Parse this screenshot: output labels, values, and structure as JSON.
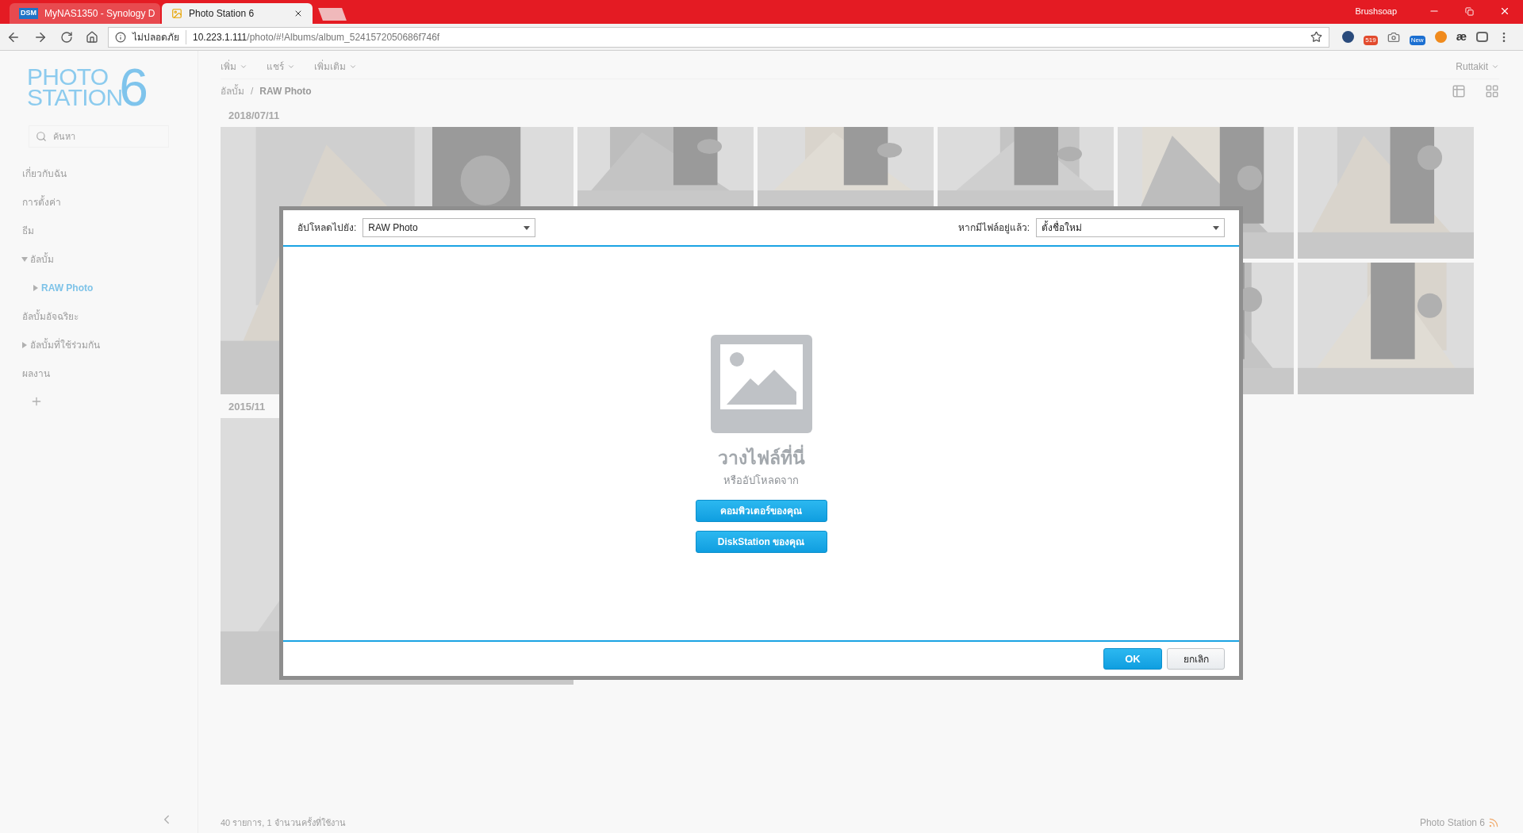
{
  "browser": {
    "tabs": [
      {
        "title": "MyNAS1350 - Synology D",
        "favicon": "DSM",
        "selected": false
      },
      {
        "title": "Photo Station 6",
        "selected": true
      }
    ],
    "profile": "Brushsoap",
    "address": {
      "security": "ไม่ปลอดภัย",
      "host": "10.223.1.111",
      "path": "/photo/#!Albums/album_5241572050686f746f"
    },
    "extension_badges": [
      "519",
      "New"
    ],
    "extension_glyph": "æ"
  },
  "app": {
    "logo": {
      "line1": "PHOTO",
      "line2": "STATION",
      "digit": "6"
    },
    "search": {
      "placeholder": "ค้นหา"
    },
    "sidebar": [
      {
        "label": "เกี่ยวกับฉัน",
        "kind": "link",
        "selected": false
      },
      {
        "label": "การตั้งค่า",
        "kind": "link",
        "selected": false
      },
      {
        "label": "ธีม",
        "kind": "link",
        "selected": false
      },
      {
        "label": "อัลบั้ม",
        "kind": "tree",
        "expanded": true,
        "selected": false,
        "children": [
          {
            "label": "RAW Photo",
            "kind": "tree",
            "expanded": false,
            "selected": true
          }
        ]
      },
      {
        "label": "อัลบั้มอัจฉริยะ",
        "kind": "link",
        "selected": false
      },
      {
        "label": "อัลบั้มที่ใช้ร่วมกัน",
        "kind": "tree",
        "expanded": false,
        "selected": false
      },
      {
        "label": "ผลงาน",
        "kind": "link",
        "selected": false
      }
    ],
    "toolbar": [
      "เพิ่ม",
      "แชร์",
      "เพิ่มเติม"
    ],
    "user": "Ruttakit",
    "breadcrumb": [
      "อัลบั้ม",
      "RAW Photo"
    ],
    "breadcrumb_separator": "/",
    "date_groups": [
      {
        "date": "2018/07/11"
      },
      {
        "date": "2015/11"
      }
    ],
    "status_text": "40 รายการ, 1 จำนวนครั้งที่ใช้งาน",
    "footer_brand": "Photo Station 6"
  },
  "dialog": {
    "upload_to": {
      "label": "อัปโหลดไปยัง:",
      "value": "RAW Photo"
    },
    "if_exists": {
      "label": "หากมีไฟล์อยู่แล้ว:",
      "value": "ตั้งชื่อใหม่"
    },
    "drop_title": "วางไฟล์ที่นี่",
    "drop_subtitle": "หรืออัปโหลดจาก",
    "sources": [
      "คอมพิวเตอร์ของคุณ",
      "DiskStation ของคุณ"
    ],
    "buttons": [
      {
        "label": "OK",
        "kind": "primary"
      },
      {
        "label": "ยกเลิก",
        "kind": "secondary"
      }
    ]
  }
}
